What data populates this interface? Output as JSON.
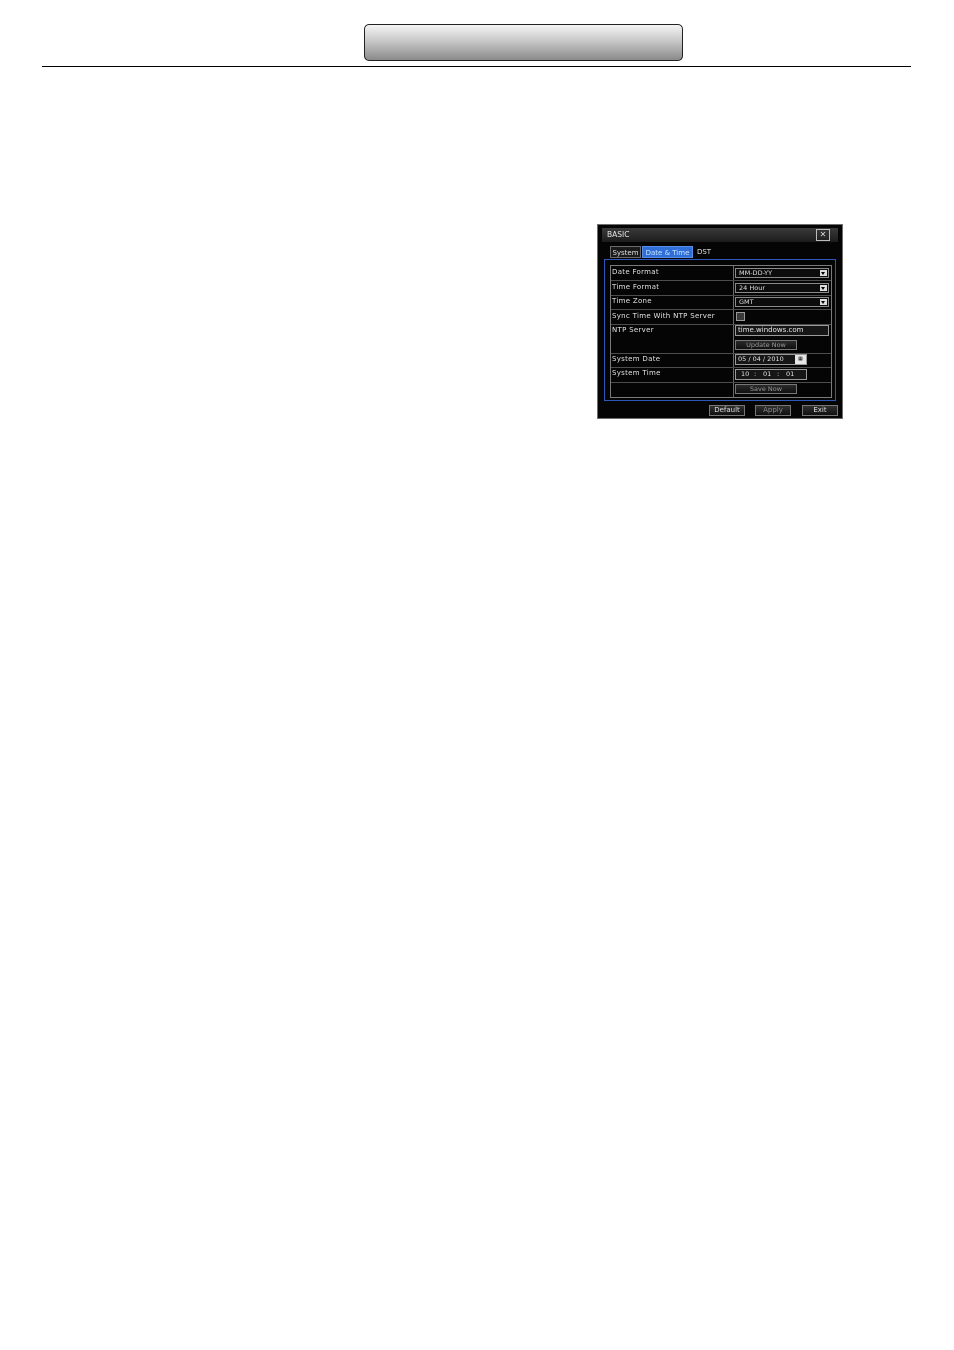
{
  "dialog": {
    "title": "BASIC",
    "close_glyph": "✕",
    "tabs": [
      {
        "label": "System"
      },
      {
        "label": "Date & Time"
      },
      {
        "label": "DST"
      }
    ],
    "active_tab": "Date & Time",
    "fields": {
      "date_format": {
        "label": "Date Format",
        "value": "MM-DD-YY"
      },
      "time_format": {
        "label": "Time Format",
        "value": "24 Hour"
      },
      "time_zone": {
        "label": "Time Zone",
        "value": "GMT"
      },
      "sync_ntp": {
        "label": "Sync Time With NTP Server",
        "checked": false
      },
      "ntp_server": {
        "label": "NTP Server",
        "value": "time.windows.com"
      },
      "update_now": {
        "label": "Update Now"
      },
      "system_date": {
        "label": "System Date",
        "value": "05 / 04 / 2010"
      },
      "system_time": {
        "label": "System Time",
        "hour": "10",
        "minute": "01",
        "second": "01",
        "separator": ":"
      },
      "save_now": {
        "label": "Save Now"
      }
    },
    "footer": {
      "default_label": "Default",
      "apply_label": "Apply",
      "exit_label": "Exit"
    },
    "colors": {
      "active_tab": "#2f6fd8",
      "panel_border": "#2e58b8",
      "background": "#050505"
    },
    "icons": {
      "close": "close-icon",
      "dropdown": "chevron-down-icon",
      "calendar": "calendar-icon"
    }
  }
}
